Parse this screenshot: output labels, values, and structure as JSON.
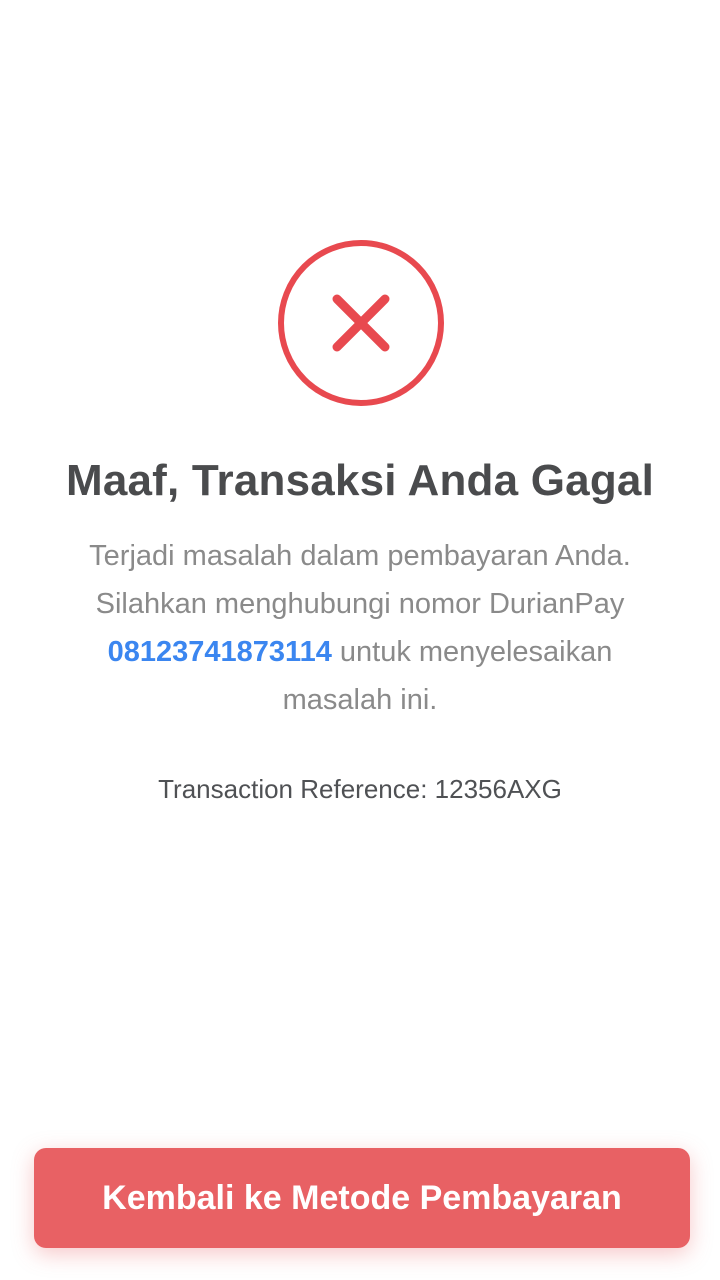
{
  "status": {
    "icon": "error-x-circle-icon",
    "color": "#e8494f"
  },
  "title": "Maaf, Transaksi Anda Gagal",
  "message": {
    "before_phone": "Terjadi masalah dalam pembayaran Anda. Silahkan menghubungi nomor DurianPay ",
    "phone": "08123741873114",
    "after_phone": " untuk menyelesaikan masalah ini."
  },
  "reference": "Transaction Reference: 12356AXG",
  "button": {
    "label": "Kembali ke Metode Pembayaran",
    "color": "#e86164"
  },
  "colors": {
    "title": "#4a4b4d",
    "body_text": "#8a8a8a",
    "link": "#3b86f0"
  }
}
